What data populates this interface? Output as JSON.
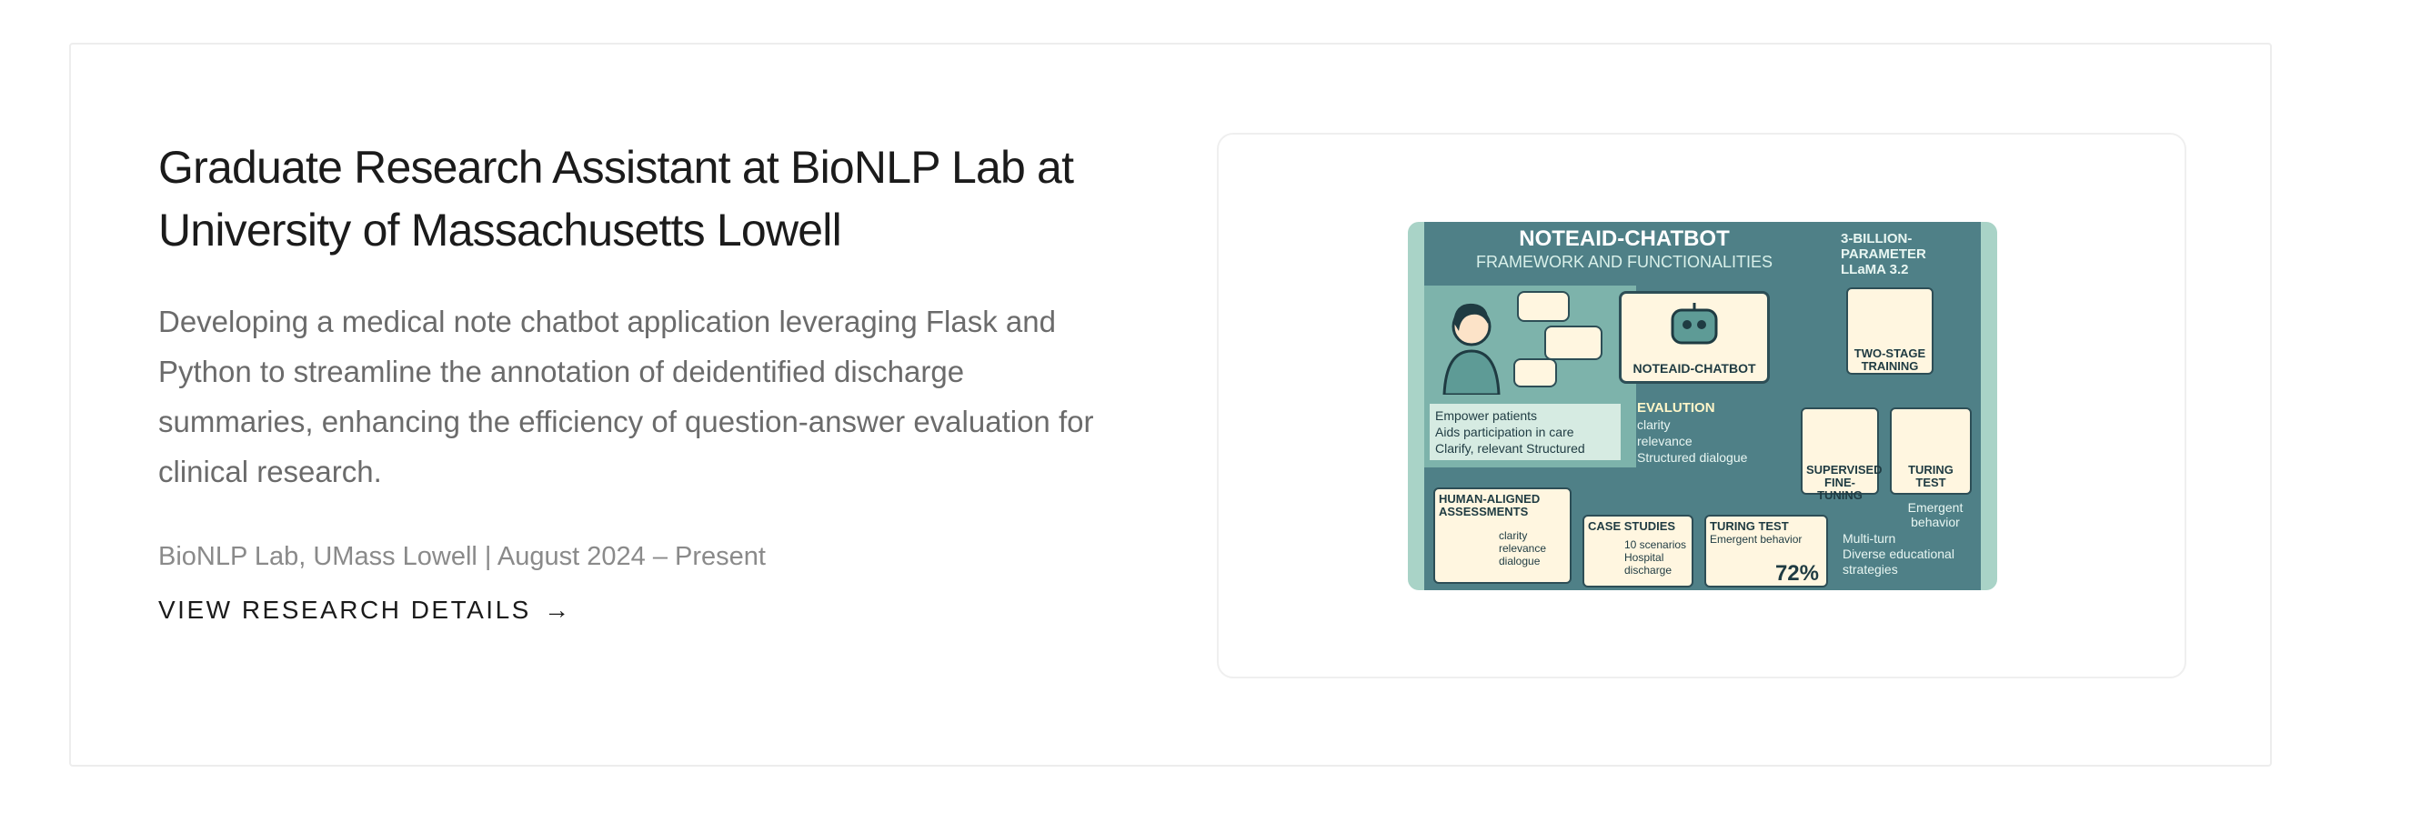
{
  "card": {
    "title": "Graduate Research Assistant at BioNLP Lab at University of Massachusetts Lowell",
    "description": "Developing a medical note chatbot application leveraging Flask and Python to streamline the annotation of deidentified discharge summaries, enhancing the efficiency of question-answer evaluation for clinical research.",
    "meta": "BioNLP Lab, UMass Lowell | August 2024 – Present",
    "link_label": "VIEW RESEARCH DETAILS",
    "link_arrow": "→"
  },
  "infographic": {
    "title": "NOTEAID-CHATBOT",
    "subtitle": "FRAMEWORK AND FUNCTIONALITIES",
    "model_label": "3-BILLION-PARAMETER LLaMA 3.2",
    "bot_label": "NOTEAID-CHATBOT",
    "patient_points": [
      "Empower patients",
      "Aids participation in care",
      "Clarify, relevant Structured"
    ],
    "evaluation_title": "EVALUTION",
    "evaluation_points": [
      "clarity",
      "relevance",
      "Structured dialogue"
    ],
    "training_label": "TWO-STAGE TRAINING",
    "sft_label": "SUPERVISED FINE-TUNING",
    "turing_label": "TURING TEST",
    "emergent_label": "Emergent behavior",
    "right_points": [
      "Multi-turn",
      "Diverse educational strategies"
    ],
    "assessments_title": "HUMAN-ALIGNED ASSESSMENTS",
    "assessments_points": [
      "clarity",
      "relevance",
      "dialogue"
    ],
    "case_title": "CASE STUDIES",
    "case_text": "10 scenarios Hospital discharge",
    "turing_box_title": "TURING TEST",
    "turing_box_sub": "Emergent behavior",
    "turing_box_value": "72%"
  }
}
